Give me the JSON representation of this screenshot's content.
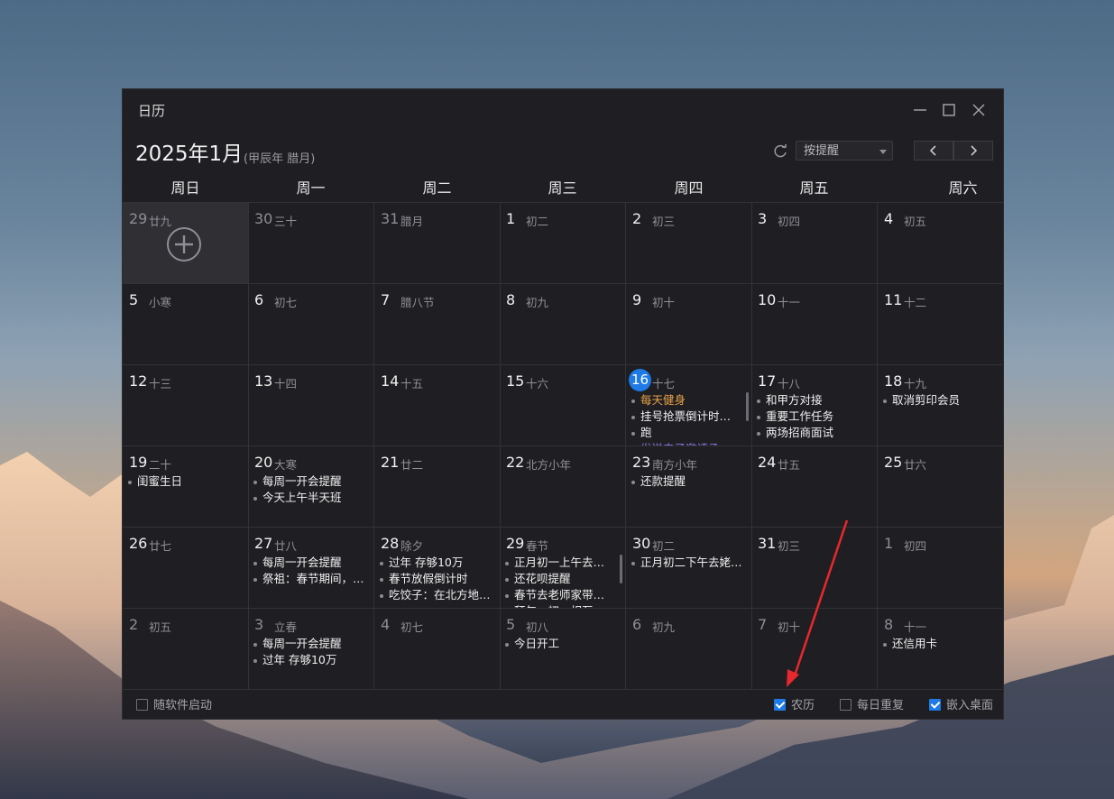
{
  "window": {
    "title": "日历"
  },
  "header": {
    "month": "2025年1月",
    "lunar_year": "(甲辰年 腊月)",
    "filter_value": "按提醒"
  },
  "weekdays": [
    "周日",
    "周一",
    "周二",
    "周三",
    "周四",
    "周五",
    "周六"
  ],
  "today_day": 16,
  "weeks": [
    [
      {
        "d": "29",
        "l": "廿九",
        "dim": true,
        "ev": []
      },
      {
        "d": "30",
        "l": "三十",
        "dim": true,
        "ev": []
      },
      {
        "d": "31",
        "l": "腊月",
        "dim": true,
        "ev": []
      },
      {
        "d": "1",
        "l": "初二",
        "ev": []
      },
      {
        "d": "2",
        "l": "初三",
        "ev": []
      },
      {
        "d": "3",
        "l": "初四",
        "ev": []
      },
      {
        "d": "4",
        "l": "初五",
        "ev": []
      }
    ],
    [
      {
        "d": "5",
        "l": "小寒",
        "ev": []
      },
      {
        "d": "6",
        "l": "初七",
        "ev": []
      },
      {
        "d": "7",
        "l": "腊八节",
        "ev": []
      },
      {
        "d": "8",
        "l": "初九",
        "ev": []
      },
      {
        "d": "9",
        "l": "初十",
        "ev": []
      },
      {
        "d": "10",
        "l": "十一",
        "ev": []
      },
      {
        "d": "11",
        "l": "十二",
        "ev": []
      }
    ],
    [
      {
        "d": "12",
        "l": "十三",
        "ev": []
      },
      {
        "d": "13",
        "l": "十四",
        "ev": []
      },
      {
        "d": "14",
        "l": "十五",
        "ev": []
      },
      {
        "d": "15",
        "l": "十六",
        "ev": []
      },
      {
        "d": "16",
        "l": "十七",
        "today": true,
        "scroll": true,
        "ev": [
          {
            "t": "每天健身",
            "c": "orange"
          },
          {
            "t": "挂号抢票倒计时怎…"
          },
          {
            "t": "跑"
          },
          {
            "t": "发送电子邀请函",
            "c": "purple"
          }
        ]
      },
      {
        "d": "17",
        "l": "十八",
        "ev": [
          {
            "t": "和甲方对接"
          },
          {
            "t": "重要工作任务"
          },
          {
            "t": "两场招商面试"
          }
        ]
      },
      {
        "d": "18",
        "l": "十九",
        "ev": [
          {
            "t": "取消剪印会员"
          }
        ]
      }
    ],
    [
      {
        "d": "19",
        "l": "二十",
        "ev": [
          {
            "t": "闺蜜生日"
          }
        ]
      },
      {
        "d": "20",
        "l": "大寒",
        "ev": [
          {
            "t": "每周一开会提醒"
          },
          {
            "t": "今天上午半天班"
          }
        ]
      },
      {
        "d": "21",
        "l": "廿二",
        "ev": []
      },
      {
        "d": "22",
        "l": "北方小年",
        "ev": []
      },
      {
        "d": "23",
        "l": "南方小年",
        "ev": [
          {
            "t": "还款提醒"
          }
        ]
      },
      {
        "d": "24",
        "l": "廿五",
        "ev": []
      },
      {
        "d": "25",
        "l": "廿六",
        "ev": []
      }
    ],
    [
      {
        "d": "26",
        "l": "廿七",
        "ev": []
      },
      {
        "d": "27",
        "l": "廿八",
        "ev": [
          {
            "t": "每周一开会提醒"
          },
          {
            "t": "祭祖：春节期间，许…"
          }
        ]
      },
      {
        "d": "28",
        "l": "除夕",
        "ev": [
          {
            "t": "过年 存够10万"
          },
          {
            "t": "春节放假倒计时"
          },
          {
            "t": "吃饺子：在北方地区…"
          }
        ]
      },
      {
        "d": "29",
        "l": "春节",
        "scroll": true,
        "ev": [
          {
            "t": "正月初一上午去爷爷…"
          },
          {
            "t": "还花呗提醒"
          },
          {
            "t": "春节去老师家带特产"
          },
          {
            "t": "拜年：初一相互拜年"
          }
        ]
      },
      {
        "d": "30",
        "l": "初二",
        "ev": [
          {
            "t": "正月初二下午去姥姥家"
          }
        ]
      },
      {
        "d": "31",
        "l": "初三",
        "ev": []
      },
      {
        "d": "1",
        "l": "初四",
        "dim": true,
        "ev": []
      }
    ],
    [
      {
        "d": "2",
        "l": "初五",
        "dim": true,
        "ev": []
      },
      {
        "d": "3",
        "l": "立春",
        "dim": true,
        "ev": [
          {
            "t": "每周一开会提醒"
          },
          {
            "t": "过年 存够10万"
          }
        ]
      },
      {
        "d": "4",
        "l": "初七",
        "dim": true,
        "ev": []
      },
      {
        "d": "5",
        "l": "初八",
        "dim": true,
        "ev": [
          {
            "t": "今日开工"
          }
        ]
      },
      {
        "d": "6",
        "l": "初九",
        "dim": true,
        "ev": []
      },
      {
        "d": "7",
        "l": "初十",
        "dim": true,
        "ev": []
      },
      {
        "d": "8",
        "l": "十一",
        "dim": true,
        "ev": [
          {
            "t": "还信用卡"
          }
        ]
      }
    ]
  ],
  "footer": {
    "autostart": {
      "label": "随软件启动",
      "checked": false
    },
    "lunar": {
      "label": "农历",
      "checked": true
    },
    "daily_repeat": {
      "label": "每日重复",
      "checked": false
    },
    "embed_desktop": {
      "label": "嵌入桌面",
      "checked": true
    }
  },
  "colors": {
    "accent": "#1e7ae6",
    "window_bg": "#1f1f23",
    "event_orange": "#e8a148",
    "event_purple": "#8b79e6",
    "annotation_arrow": "#e8282c"
  }
}
